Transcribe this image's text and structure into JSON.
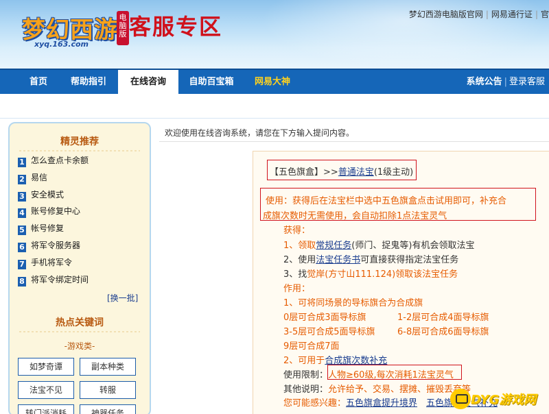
{
  "header": {
    "logo_text": "梦幻西游",
    "logo_sub": "xyq.163.com",
    "logo_badge": "电脑版",
    "site_title": "客服专区",
    "links": [
      "梦幻西游电脑版官网",
      "网易通行证",
      "官"
    ]
  },
  "nav": {
    "items": [
      "首页",
      "帮助指引",
      "在线咨询",
      "自助百宝箱",
      "网易大神"
    ],
    "right": [
      "系统公告",
      "登录客服"
    ]
  },
  "sidebar": {
    "title": "精灵推荐",
    "items": [
      "怎么查点卡余额",
      "易信",
      "安全模式",
      "账号修复中心",
      "帐号修复",
      "将军令服务器",
      "手机将军令",
      "将军令绑定时间"
    ],
    "refresh": "[换一批]",
    "hot_title": "热点关键词",
    "category": "-游戏类-",
    "keywords": [
      "如梦奇谭",
      "副本种类",
      "法宝不见",
      "转服",
      "转门派消耗",
      "神器任务"
    ]
  },
  "main": {
    "welcome": "欢迎使用在线咨询系统，请您在下方输入提问内容。",
    "item_name": "【五色旗盒】",
    "item_arrow": ">>",
    "item_link": "普通法宝",
    "item_level": "(1级主动)",
    "usage_line1": "使用：获得后在法宝栏中选中五色旗盒点击试用即可，补充合",
    "usage_line2": "成旗次数时无需使用，会自动扣除1点法宝灵气",
    "obtain_title": "获得：",
    "obtain1_prefix": "1、领取",
    "obtain1_link": "常规任务",
    "obtain1_suffix": "(师门、捉鬼等)有机会领取法宝",
    "obtain2_prefix": "2、使用",
    "obtain2_link": "法宝任务书",
    "obtain2_suffix": "可直接获得指定法宝任务",
    "obtain3_prefix": "3、找",
    "obtain3_rest": "觉岸(方寸山111.124)领取该法宝任务",
    "effect_title": "作用：",
    "effect1": "1、可将同场景的导标旗合为合成旗",
    "e_l1": "0层可合成3面导标旗",
    "e_r1": "1-2层可合成4面导标旗",
    "e_l2": "3-5层可合成5面导标旗",
    "e_r2": "6-8层可合成6面导标旗",
    "e_l3": "9层可合成7面",
    "effect2_prefix": "2、可用于",
    "effect2_link": "合成旗次数补充",
    "limit_label": "使用限制：",
    "limit_value": "人物≥60级,每次消耗1法宝灵气",
    "other_label": "其他说明：",
    "other_value": "允许给予、交易、摆摊、摧毁丢弃等",
    "maybe_label": "您可能感兴趣：",
    "maybe1": "五色旗盒提升境界",
    "maybe2": "五色旗盒灵气补充"
  },
  "watermark": "DYG游戏网"
}
